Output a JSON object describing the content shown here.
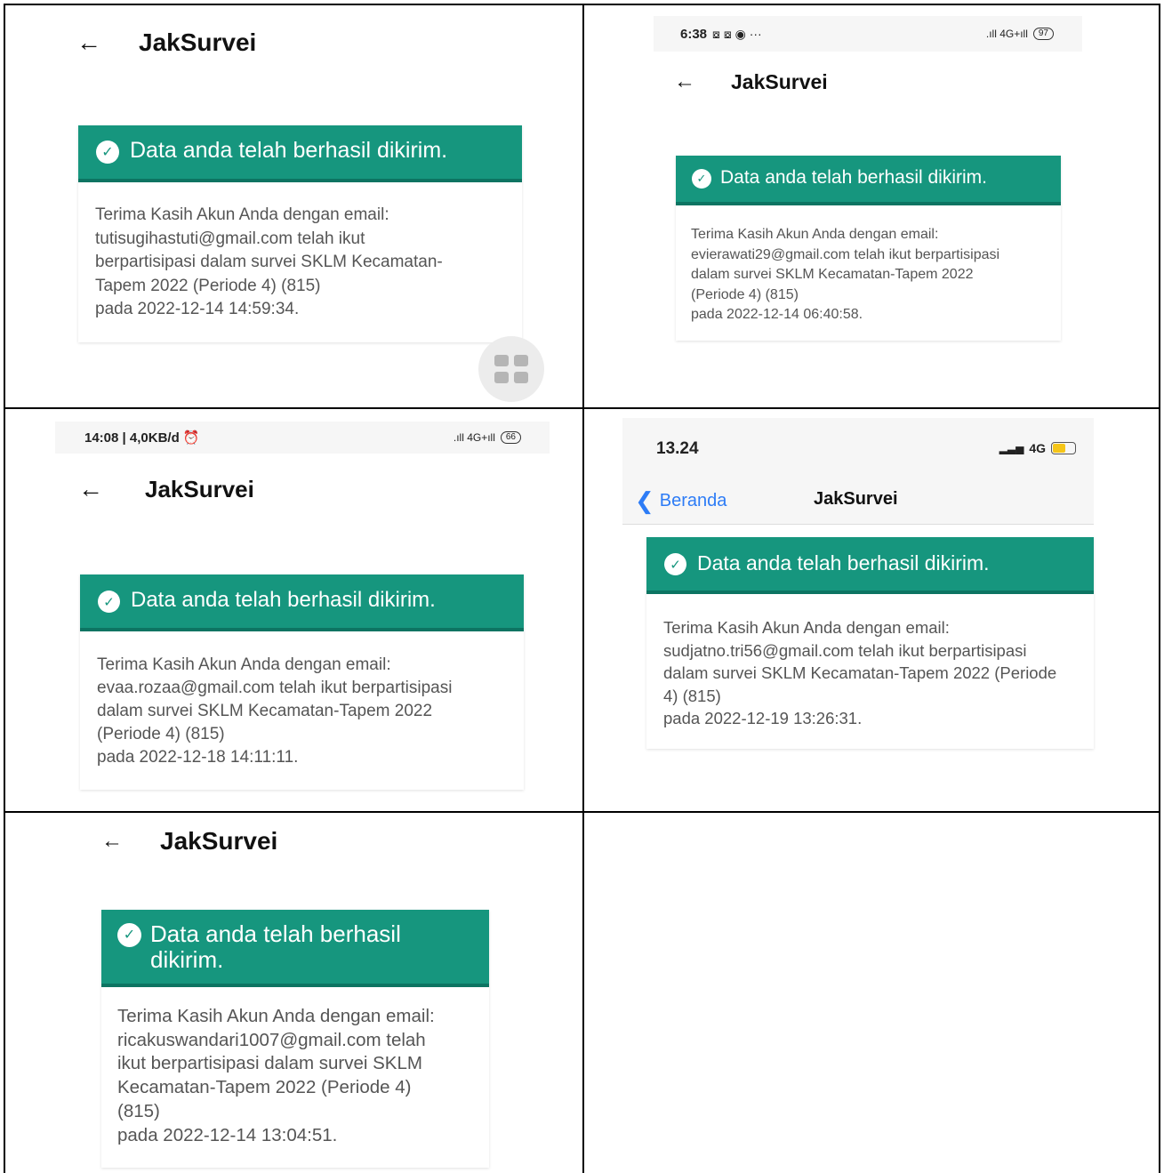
{
  "app_title": "JakSurvei",
  "banner_text": "Data anda telah berhasil dikirim.",
  "panels": [
    {
      "body": "Terima Kasih Akun Anda dengan email:\ntutisugihastuti@gmail.com telah ikut\nberpartisipasi dalam survei SKLM Kecamatan-\nTapem 2022 (Periode 4) (815)\npada 2022-12-14 14:59:34."
    },
    {
      "status_time": "6:38",
      "status_icons": "⧇ ⧇ ◉  ···",
      "signal": ".ıll 4G+ıll",
      "battery": "97",
      "body": "Terima Kasih Akun Anda dengan email:\nevierawati29@gmail.com telah ikut berpartisipasi\ndalam survei SKLM Kecamatan-Tapem 2022\n(Periode 4) (815)\npada 2022-12-14 06:40:58."
    },
    {
      "status_time": "14:08 | 4,0KB/d ⏰",
      "signal": ".ıll 4G+ıll",
      "battery": "66",
      "body": "Terima Kasih Akun Anda dengan email:\nevaa.rozaa@gmail.com telah ikut berpartisipasi\ndalam survei SKLM Kecamatan-Tapem 2022\n(Periode 4) (815)\npada 2022-12-18 14:11:11."
    },
    {
      "status_time": "13.24",
      "signal_label": "4G",
      "back_label": "Beranda",
      "body": "Terima Kasih Akun Anda dengan email:\nsudjatno.tri56@gmail.com telah ikut berpartisipasi\ndalam survei SKLM Kecamatan-Tapem 2022 (Periode\n4) (815)\npada 2022-12-19 13:26:31."
    },
    {
      "body": "Terima Kasih Akun Anda dengan email:\nricakuswandari1007@gmail.com telah\nikut berpartisipasi dalam survei SKLM\nKecamatan-Tapem 2022 (Periode 4)\n(815)\npada 2022-12-14 13:04:51."
    }
  ]
}
